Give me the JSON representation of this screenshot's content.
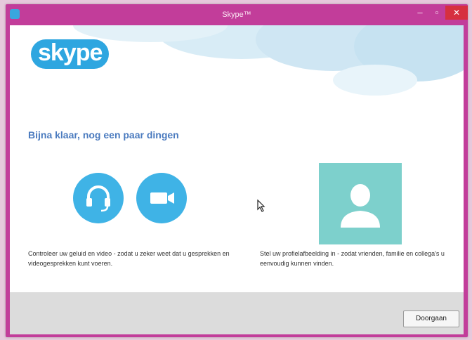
{
  "window": {
    "title": "Skype™",
    "minimize_glyph": "–",
    "maximize_glyph": "▫",
    "close_glyph": "✕"
  },
  "brand": {
    "logo_text": "skype",
    "accent": "#2ea6e0",
    "frame_color": "#c23d9a",
    "tile_color": "#7dd0cc"
  },
  "main": {
    "headline": "Bijna klaar, nog een paar dingen",
    "audio_video": {
      "headset_icon": "headset-icon",
      "video_icon": "video-camera-icon",
      "description": "Controleer uw geluid en video - zodat u zeker weet dat u gesprekken en videogesprekken kunt voeren."
    },
    "profile": {
      "icon": "user-silhouette-icon",
      "description": "Stel uw profielafbeelding in - zodat vrienden, familie en collega's u eenvoudig kunnen vinden."
    }
  },
  "footer": {
    "next_label": "Doorgaan"
  }
}
